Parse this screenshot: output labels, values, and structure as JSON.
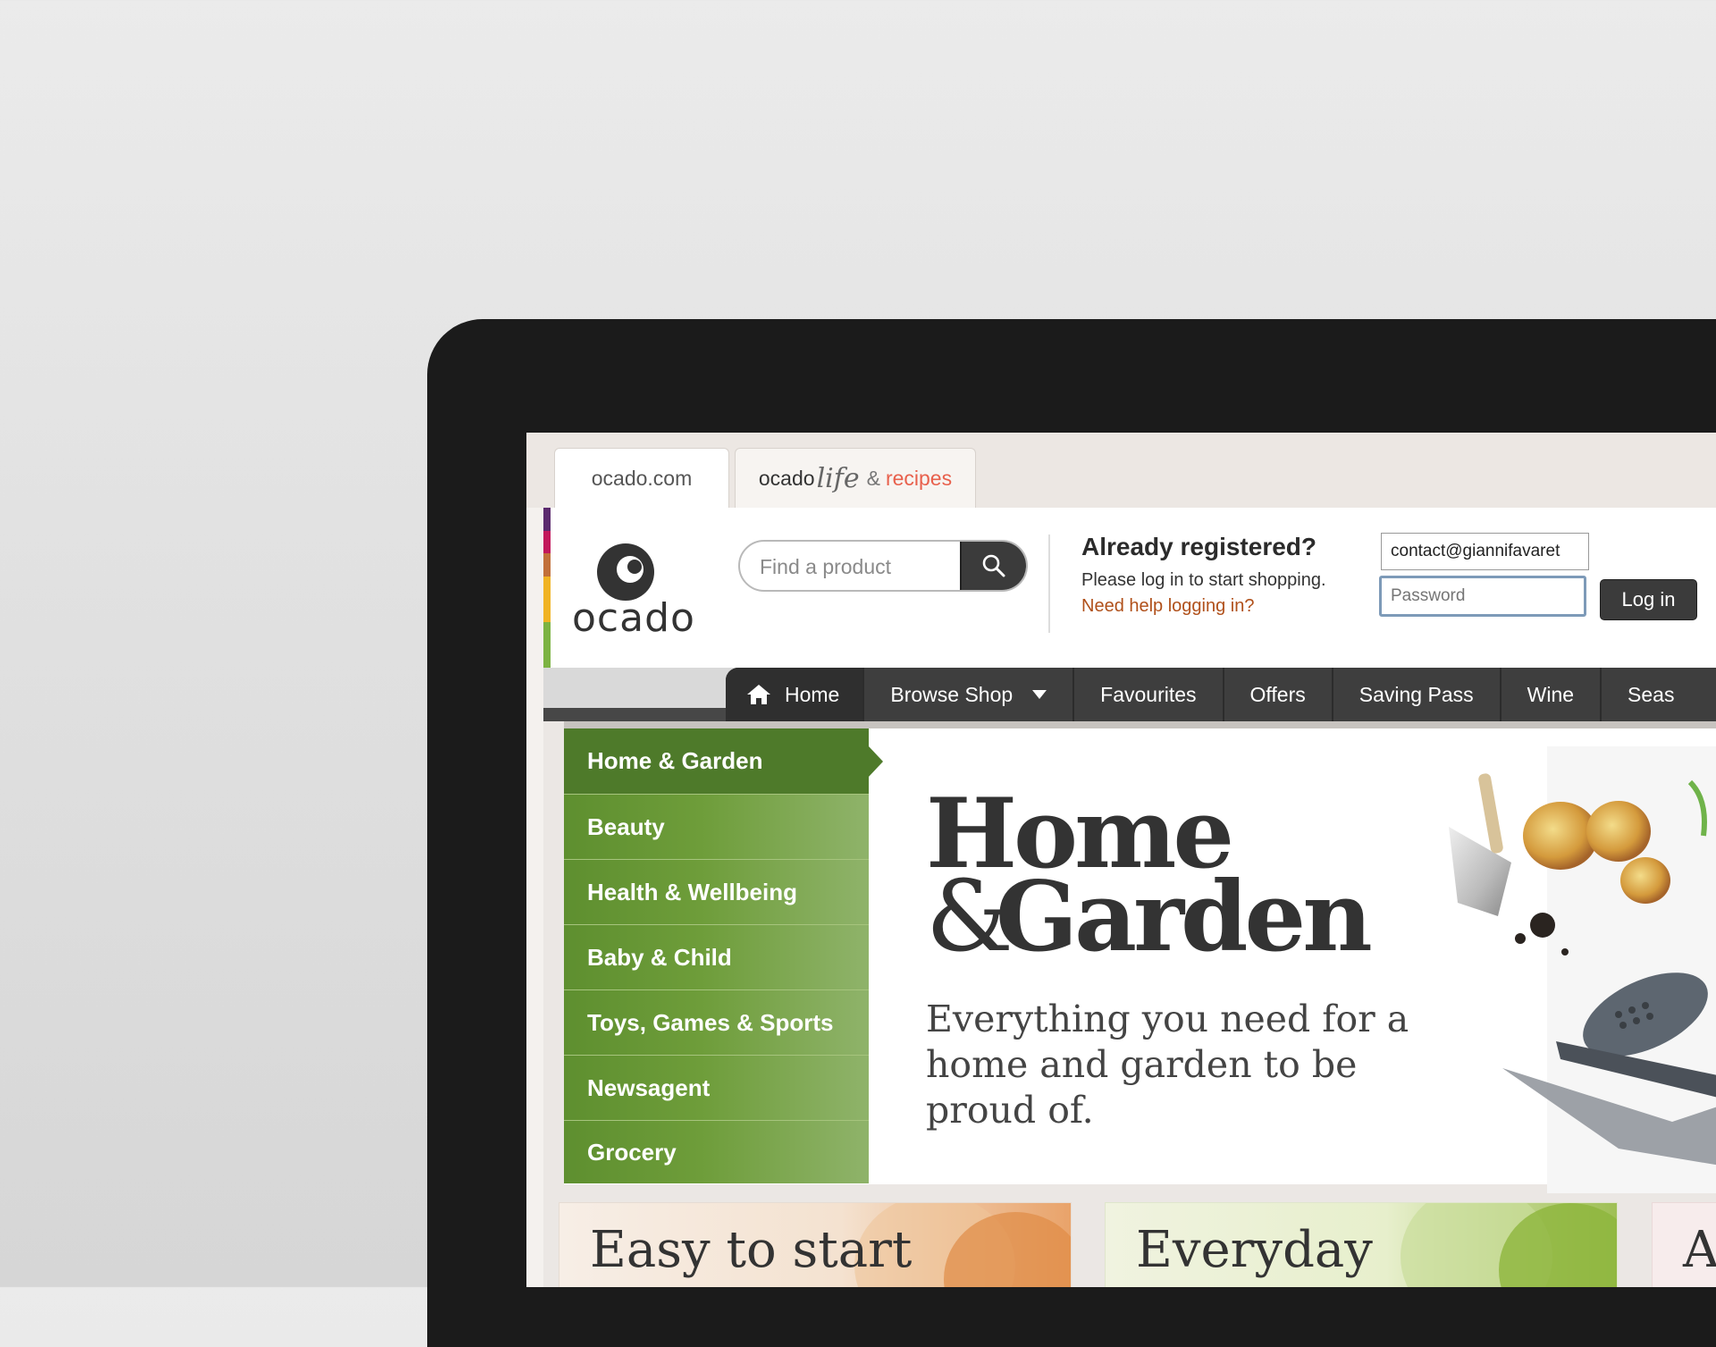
{
  "tabs": [
    {
      "label": "ocado.com"
    },
    {
      "label_main": "ocado",
      "label_life": "life",
      "label_amp": "&",
      "label_recipes": "recipes"
    }
  ],
  "brand": {
    "logo_text": "ocado",
    "stripe_colors": [
      "#5b2a6e",
      "#c2185b",
      "#c2703a",
      "#f0b323",
      "#7cb342"
    ]
  },
  "search": {
    "placeholder": "Find a product",
    "icon": "search-icon"
  },
  "login": {
    "title": "Already registered?",
    "subtitle": "Please log in to start shopping.",
    "help_link": "Need help logging in?",
    "email_value": "contact@giannifavaret",
    "password_placeholder": "Password",
    "button_label": "Log in"
  },
  "nav": {
    "items": [
      {
        "label": "Home",
        "icon": "home-icon"
      },
      {
        "label": "Browse Shop",
        "icon": "chevron-down-icon"
      },
      {
        "label": "Favourites"
      },
      {
        "label": "Offers"
      },
      {
        "label": "Saving Pass"
      },
      {
        "label": "Wine"
      },
      {
        "label": "Seas"
      }
    ]
  },
  "categories": [
    "Home & Garden",
    "Beauty",
    "Health & Wellbeing",
    "Baby & Child",
    "Toys, Games & Sports",
    "Newsagent",
    "Grocery"
  ],
  "hero": {
    "title_line1": "Home",
    "title_amp": "&",
    "title_line2": "Garden",
    "subtitle": "Everything you need for a home and garden to be proud of."
  },
  "promos": [
    {
      "text": "Easy to start"
    },
    {
      "text": "Everyday"
    },
    {
      "text": "A"
    }
  ],
  "colors": {
    "accent_green": "#4e7a2a",
    "nav_dark": "#3e3e3e",
    "link_orange": "#b0501a",
    "recipes_red": "#e8604c"
  }
}
